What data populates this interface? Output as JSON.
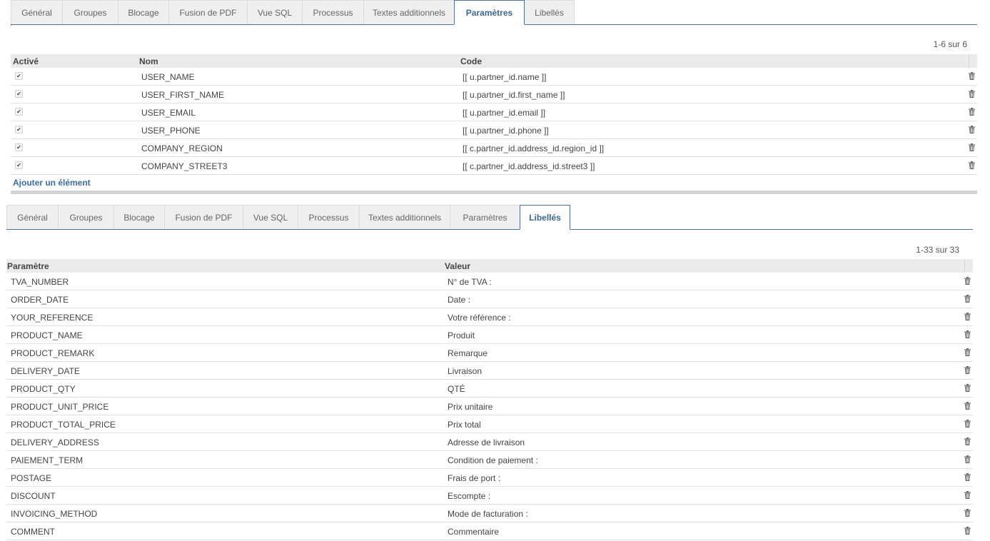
{
  "panel1": {
    "tabs": [
      {
        "label": "Général",
        "active": false
      },
      {
        "label": "Groupes",
        "active": false
      },
      {
        "label": "Blocage",
        "active": false
      },
      {
        "label": "Fusion de PDF",
        "active": false
      },
      {
        "label": "Vue SQL",
        "active": false
      },
      {
        "label": "Processus",
        "active": false
      },
      {
        "label": "Textes additionnels",
        "active": false
      },
      {
        "label": "Paramètres",
        "active": true
      },
      {
        "label": "Libellés",
        "active": false
      }
    ],
    "pager": "1-6 sur 6",
    "columns": {
      "active": "Activé",
      "name": "Nom",
      "code": "Code"
    },
    "rows": [
      {
        "active": true,
        "name": "USER_NAME",
        "code": "[[ u.partner_id.name ]]"
      },
      {
        "active": true,
        "name": "USER_FIRST_NAME",
        "code": "[[ u.partner_id.first_name ]]"
      },
      {
        "active": true,
        "name": "USER_EMAIL",
        "code": "[[ u.partner_id.email ]]"
      },
      {
        "active": true,
        "name": "USER_PHONE",
        "code": "[[ u.partner_id.phone ]]"
      },
      {
        "active": true,
        "name": "COMPANY_REGION",
        "code": "[[ c.partner_id.address_id.region_id ]]"
      },
      {
        "active": true,
        "name": "COMPANY_STREET3",
        "code": "[[ c.partner_id.address_id.street3 ]]"
      }
    ],
    "add_label": "Ajouter un élément"
  },
  "panel2": {
    "tabs": [
      {
        "label": "Général",
        "active": false
      },
      {
        "label": "Groupes",
        "active": false
      },
      {
        "label": "Blocage",
        "active": false
      },
      {
        "label": "Fusion de PDF",
        "active": false
      },
      {
        "label": "Vue SQL",
        "active": false
      },
      {
        "label": "Processus",
        "active": false
      },
      {
        "label": "Textes additionnels",
        "active": false
      },
      {
        "label": "Paramètres",
        "active": false
      },
      {
        "label": "Libellés",
        "active": true
      }
    ],
    "pager": "1-33 sur 33",
    "columns": {
      "param": "Paramètre",
      "value": "Valeur"
    },
    "rows": [
      {
        "param": "TVA_NUMBER",
        "value": "N° de TVA :"
      },
      {
        "param": "ORDER_DATE",
        "value": "Date :"
      },
      {
        "param": "YOUR_REFERENCE",
        "value": "Votre référence :"
      },
      {
        "param": "PRODUCT_NAME",
        "value": "Produit"
      },
      {
        "param": "PRODUCT_REMARK",
        "value": "Remarque"
      },
      {
        "param": "DELIVERY_DATE",
        "value": "Livraison"
      },
      {
        "param": "PRODUCT_QTY",
        "value": "QTÉ"
      },
      {
        "param": "PRODUCT_UNIT_PRICE",
        "value": "Prix unitaire"
      },
      {
        "param": "PRODUCT_TOTAL_PRICE",
        "value": "Prix total"
      },
      {
        "param": "DELIVERY_ADDRESS",
        "value": "Adresse de livraison"
      },
      {
        "param": "PAIEMENT_TERM",
        "value": "Condition de paiement :"
      },
      {
        "param": "POSTAGE",
        "value": "Frais de port :"
      },
      {
        "param": "DISCOUNT",
        "value": "Escompte :"
      },
      {
        "param": "INVOICING_METHOD",
        "value": "Mode de facturation :"
      },
      {
        "param": "COMMENT",
        "value": "Commentaire"
      }
    ]
  },
  "icons": {
    "delete": "trash-icon",
    "check": "check-icon"
  },
  "colors": {
    "accent": "#3a6791",
    "link": "#3a6ea5",
    "tab_border": "#4d7497"
  }
}
